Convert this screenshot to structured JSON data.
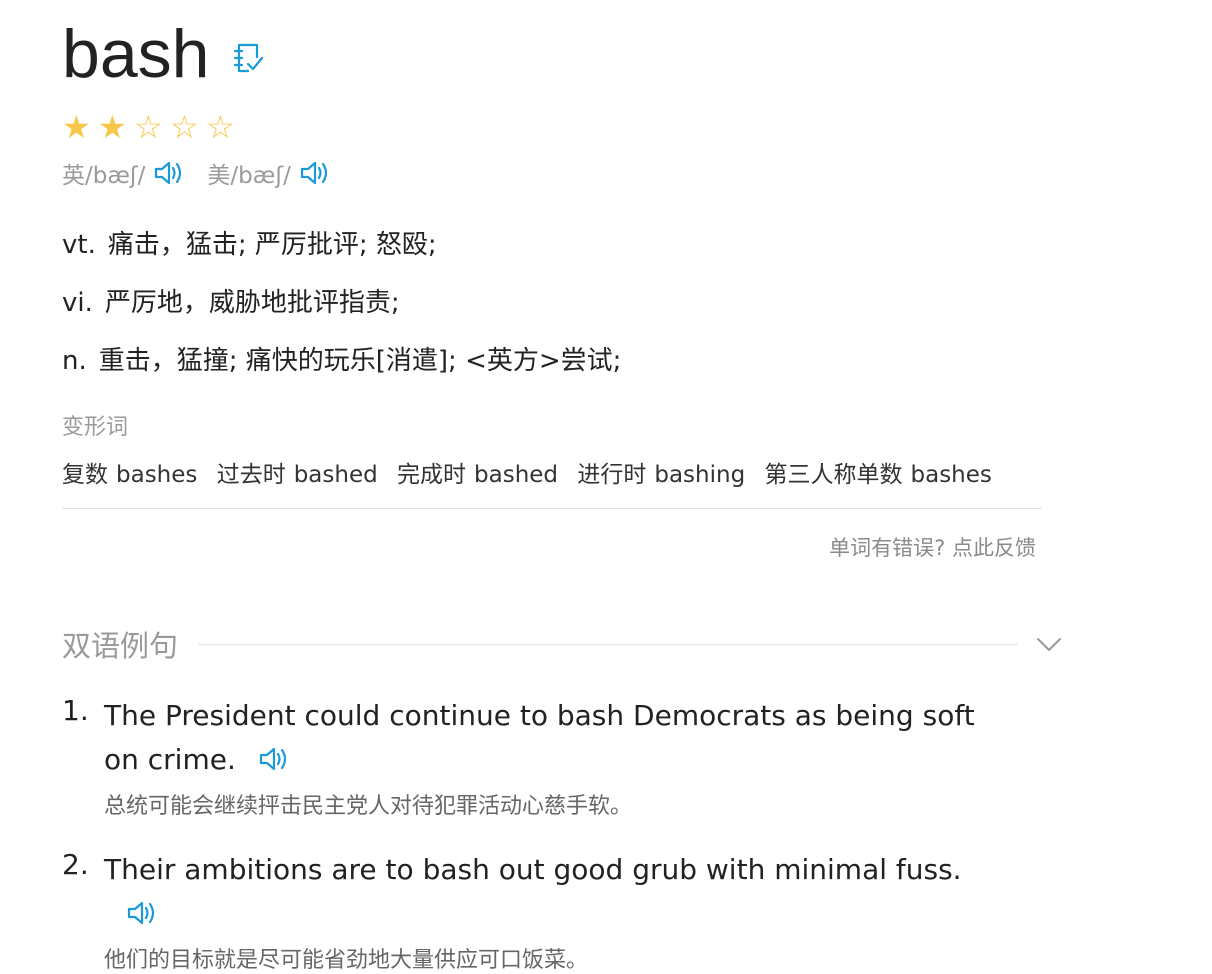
{
  "word": "bash",
  "icons": {
    "wordbook": "add-to-wordbook-icon",
    "speaker": "speaker-icon",
    "chevron": "chevron-down-icon",
    "star_full": "star-filled-icon",
    "star_empty": "star-outline-icon"
  },
  "colors": {
    "accent": "#1a9bd7",
    "star": "#f7c64a",
    "muted": "#9a9a9a"
  },
  "rating": {
    "value": 2,
    "max": 5,
    "stars": [
      "★",
      "★",
      "☆",
      "☆",
      "☆"
    ]
  },
  "phonetics": [
    {
      "text": "英/bæʃ/"
    },
    {
      "text": "美/bæʃ/"
    }
  ],
  "definitions": [
    {
      "pos": "vt.",
      "meaning": "痛击，猛击; 严厉批评; 怒殴;"
    },
    {
      "pos": "vi.",
      "meaning": "严厉地，威胁地批评指责;"
    },
    {
      "pos": "n.",
      "meaning": "重击，猛撞; 痛快的玩乐[消遣]; <英方>尝试;"
    }
  ],
  "forms": {
    "label": "变形词",
    "items": [
      {
        "label": "复数",
        "value": "bashes"
      },
      {
        "label": "过去时",
        "value": "bashed"
      },
      {
        "label": "完成时",
        "value": "bashed"
      },
      {
        "label": "进行时",
        "value": "bashing"
      },
      {
        "label": "第三人称单数",
        "value": "bashes"
      }
    ]
  },
  "feedback": "单词有错误? 点此反馈",
  "examples": {
    "title": "双语例句",
    "items": [
      {
        "num": "1.",
        "en": "The President could continue to bash Democrats as being soft on crime.",
        "cn": "总统可能会继续抨击民主党人对待犯罪活动心慈手软。"
      },
      {
        "num": "2.",
        "en": "Their ambitions are to bash out good grub with minimal fuss.",
        "cn": "他们的目标就是尽可能省劲地大量供应可口饭菜。"
      }
    ]
  }
}
